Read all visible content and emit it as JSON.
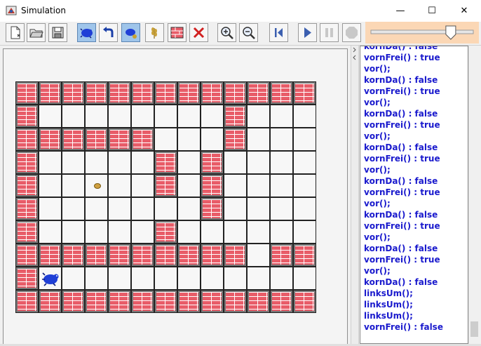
{
  "window": {
    "title": "Simulation",
    "minimize": "—",
    "maximize": "☐",
    "close": "✕"
  },
  "toolbar": {
    "icons": [
      "new-file-icon",
      "open-folder-icon",
      "save-icon",
      "hamster-icon",
      "turn-left-icon",
      "hamster-grain-icon",
      "grain-icon",
      "wall-icon",
      "delete-icon",
      "zoom-in-icon",
      "zoom-out-icon",
      "step-back-icon",
      "play-icon",
      "pause-icon",
      "stop-icon"
    ]
  },
  "speed": {
    "value": 0.78
  },
  "territory": {
    "rows": [
      "#############",
      "#........#...#",
      "######...#...#",
      "#.....#.#....#",
      "#.....#.#....#",
      "#.......#....#",
      "#.....#......#",
      "##########.###",
      "#H...........#",
      "#############"
    ],
    "grain": {
      "row": 4,
      "col": 3
    },
    "hamster": {
      "row": 8,
      "col": 1
    }
  },
  "log": {
    "lines": [
      "kornDa() : false",
      "vornFrei() : true",
      "vor();",
      "kornDa() : false",
      "vornFrei() : true",
      "vor();",
      "kornDa() : false",
      "vornFrei() : true",
      "vor();",
      "kornDa() : false",
      "vornFrei() : true",
      "vor();",
      "kornDa() : false",
      "vornFrei() : true",
      "vor();",
      "kornDa() : false",
      "vornFrei() : true",
      "vor();",
      "kornDa() : false",
      "vornFrei() : true",
      "vor();",
      "kornDa() : false",
      "linksUm();",
      "linksUm();",
      "linksUm();",
      "vornFrei() : false"
    ]
  }
}
